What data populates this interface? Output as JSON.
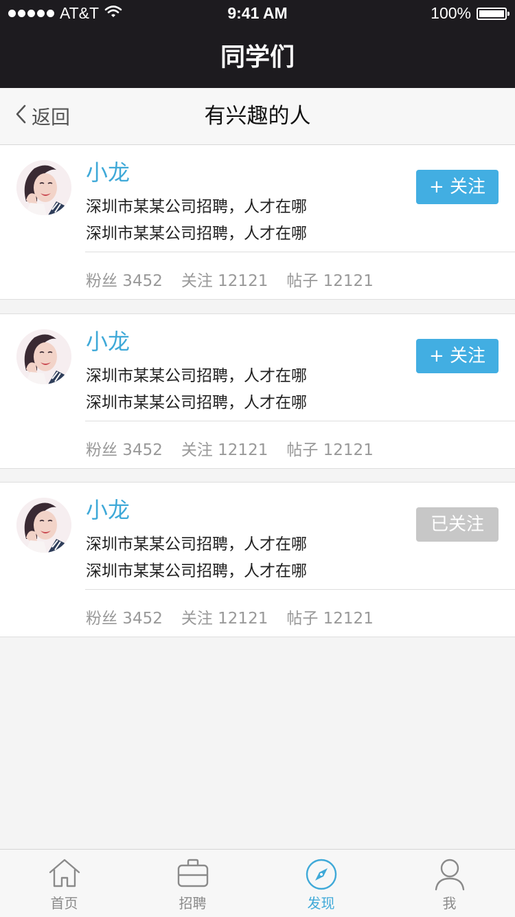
{
  "status_bar": {
    "carrier": "AT&T",
    "time": "9:41 AM",
    "battery": "100%"
  },
  "title_bar": {
    "title": "同学们"
  },
  "nav_bar": {
    "back_label": "返回",
    "title": "有兴趣的人"
  },
  "people": [
    {
      "name": "小龙",
      "line1": "深圳市某某公司招聘，人才在哪",
      "line2": "深圳市某某公司招聘，人才在哪",
      "fans": "粉丝 3452",
      "following": "关注 12121",
      "posts": "帖子 12121",
      "button": "+ 关注",
      "followed": false
    },
    {
      "name": "小龙",
      "line1": "深圳市某某公司招聘，人才在哪",
      "line2": "深圳市某某公司招聘，人才在哪",
      "fans": "粉丝 3452",
      "following": "关注 12121",
      "posts": "帖子 12121",
      "button": "+ 关注",
      "followed": false
    },
    {
      "name": "小龙",
      "line1": "深圳市某某公司招聘，人才在哪",
      "line2": "深圳市某某公司招聘，人才在哪",
      "fans": "粉丝 3452",
      "following": "关注 12121",
      "posts": "帖子 12121",
      "button": "已关注",
      "followed": true
    }
  ],
  "tab_bar": {
    "items": [
      {
        "label": "首页",
        "icon": "home-icon",
        "active": false
      },
      {
        "label": "招聘",
        "icon": "briefcase-icon",
        "active": false
      },
      {
        "label": "发现",
        "icon": "compass-icon",
        "active": true
      },
      {
        "label": "我",
        "icon": "person-icon",
        "active": false
      }
    ]
  },
  "colors": {
    "accent": "#3fa9d8",
    "button_blue": "#42aee2",
    "button_gray": "#c7c7c7",
    "header_bg": "#1d1b1f"
  }
}
